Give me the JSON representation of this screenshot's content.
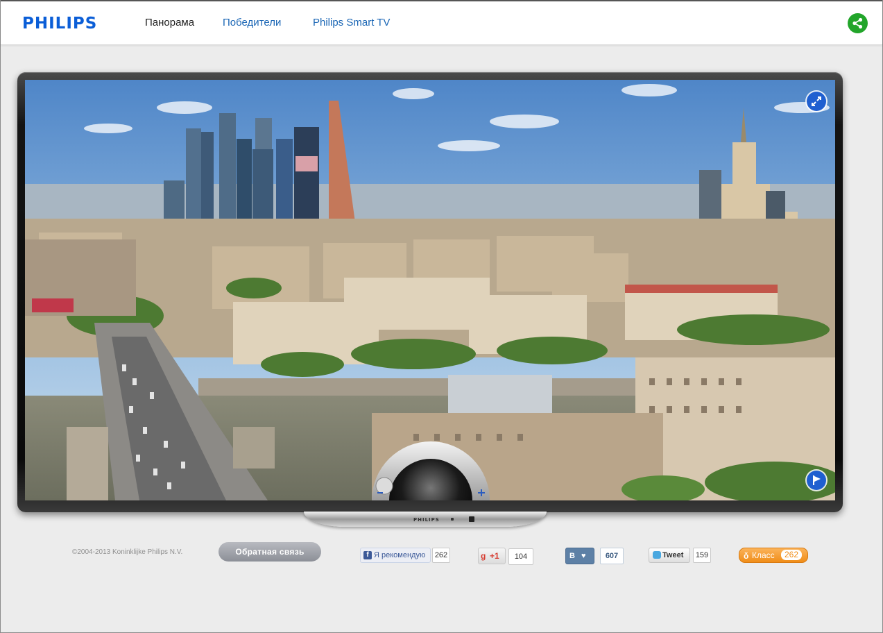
{
  "header": {
    "logo": "PHILIPS",
    "nav": [
      {
        "label": "Панорама",
        "active": true
      },
      {
        "label": "Победители",
        "active": false
      },
      {
        "label": "Philips Smart TV",
        "active": false
      }
    ],
    "share_icon": "share-icon",
    "accent_color": "#0b5ed7"
  },
  "tv": {
    "screen_content": "panorama",
    "stand_brand": "PHILIPS",
    "fullscreen_icon": "expand-icon",
    "flag_icon": "flag-icon",
    "zoom_minus": "−",
    "zoom_plus": "+"
  },
  "footer": {
    "copyright": "©2004-2013 Koninklijke Philips N.V.",
    "feedback_label": "Обратная связь",
    "social": {
      "facebook": {
        "label": "Я рекомендую",
        "count": "262"
      },
      "gplus": {
        "label": "+1",
        "count": "104"
      },
      "vk": {
        "label": "В",
        "count": "607"
      },
      "twitter": {
        "label": "Tweet",
        "count": "159"
      },
      "odnoklassniki": {
        "label": "Класс",
        "count": "262"
      }
    }
  }
}
